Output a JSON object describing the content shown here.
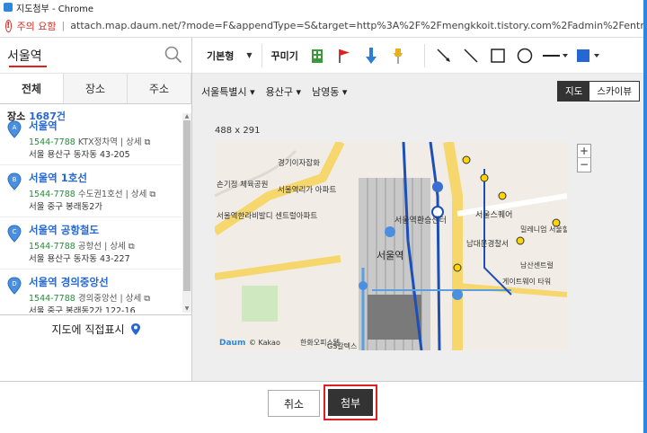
{
  "window": {
    "title": "지도첨부 - Chrome",
    "warning": "주의 요함",
    "url": "attach.map.daum.net/?mode=F&appendType=S&target=http%3A%2F%2Fmengkkoit.tistory.com%2Fadmin%2Fentry%2F"
  },
  "search": {
    "value": "서울역"
  },
  "tabs": [
    "전체",
    "장소",
    "주소"
  ],
  "result": {
    "label": "장소",
    "count": "1687건"
  },
  "results": [
    {
      "marker": "A",
      "name": "서울역",
      "phone": "1544-7788",
      "extra": "KTX정차역",
      "detail": "상세",
      "address": "서울 용산구 동자동 43-205"
    },
    {
      "marker": "B",
      "name": "서울역 1호선",
      "phone": "1544-7788",
      "extra": "수도권1호선",
      "detail": "상세",
      "address": "서울 중구 봉래동2가"
    },
    {
      "marker": "C",
      "name": "서울역 공항철도",
      "phone": "1544-7788",
      "extra": "공항선",
      "detail": "상세",
      "address": "서울 용산구 동자동 43-227"
    },
    {
      "marker": "D",
      "name": "서울역 경의중앙선",
      "phone": "1544-7788",
      "extra": "경의중앙선",
      "detail": "상세",
      "address": "서울 중구 봉래동2가 122-16"
    }
  ],
  "direct_mark": "지도에 직접표시",
  "toolbar": {
    "basic": "기본형",
    "decorate": "꾸미기"
  },
  "region": [
    "서울특별시",
    "용산구",
    "남영동"
  ],
  "maptypes": [
    "지도",
    "스카이뷰"
  ],
  "map": {
    "size": "488 x 291",
    "labels": {
      "seoul_station": "서울역",
      "station_bus": "서울역환승센터",
      "seoul_square": "서울스퀘어",
      "gyeongi": "경기이자잡화",
      "seoul_st_apt": "서울역리가 아파트",
      "seoul_bus_transfer": "서울역버스환승센터",
      "namdaemun": "남대문경찰서",
      "millennium": "밀레니엄 서울힐튼",
      "namsan": "남산센트럴",
      "gateway": "게이트웨이 타워",
      "seoul_central": "서울역한라비발디 센트럴아파트",
      "sogiho": "손기정 체육공원",
      "logo": "Daum",
      "copyright": "© Kakao",
      "hotel": "한화오피스텔",
      "gs": "GS칼텍스"
    }
  },
  "buttons": {
    "cancel": "취소",
    "attach": "첨부"
  },
  "colors": {
    "accent": "#2568d3",
    "highlight": "#e02020",
    "route": "#1c4fb8"
  }
}
